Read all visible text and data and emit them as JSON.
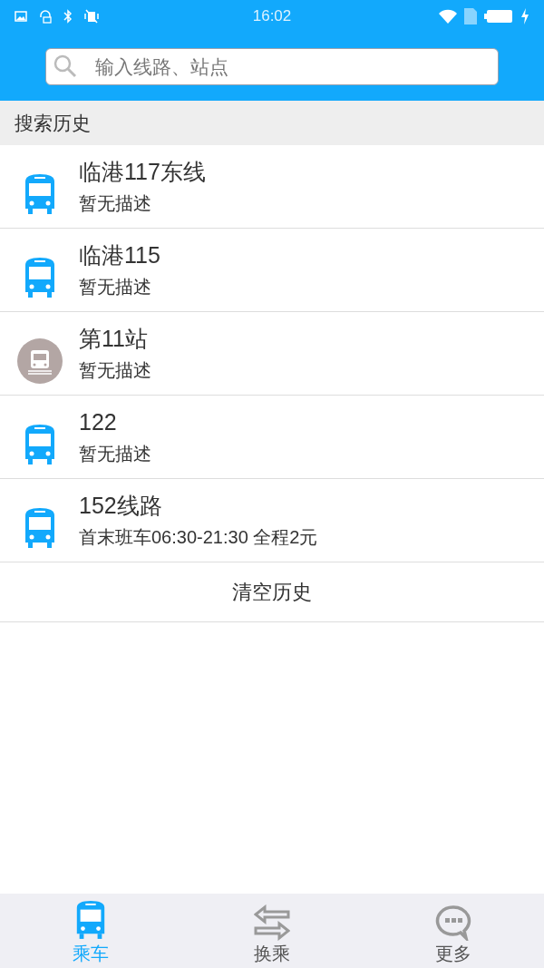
{
  "status_bar": {
    "time": "16:02"
  },
  "search": {
    "placeholder": "输入线路、站点"
  },
  "history": {
    "title": "搜索历史",
    "items": [
      {
        "kind": "bus",
        "name": "临港117东线",
        "description": "暂无描述"
      },
      {
        "kind": "bus",
        "name": "临港115",
        "description": "暂无描述"
      },
      {
        "kind": "station",
        "name": "第11站",
        "description": "暂无描述"
      },
      {
        "kind": "bus",
        "name": "122",
        "description": "暂无描述"
      },
      {
        "kind": "bus",
        "name": "152线路",
        "description": "首末班车06:30-21:30 全程2元"
      }
    ],
    "clear_button": "清空历史"
  },
  "tabs": [
    {
      "kind": "ride",
      "label": "乘车",
      "selected": true
    },
    {
      "kind": "transfer",
      "label": "换乘",
      "selected": false
    },
    {
      "kind": "more",
      "label": "更多",
      "selected": false
    }
  ]
}
